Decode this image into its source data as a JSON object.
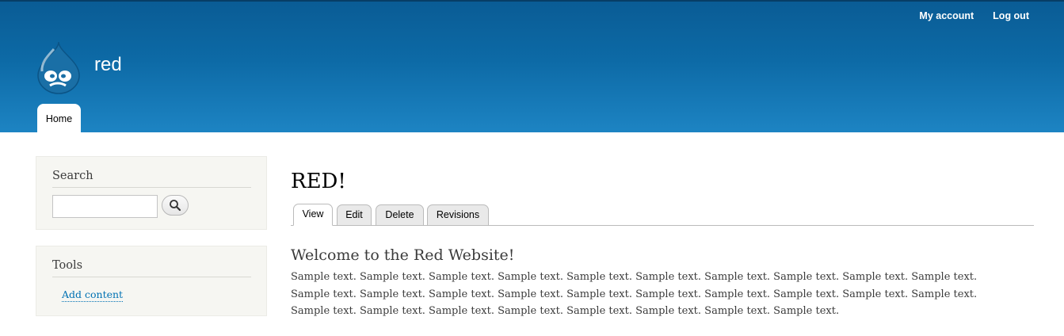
{
  "site": {
    "name": "red"
  },
  "user_menu": {
    "my_account": "My account",
    "log_out": "Log out"
  },
  "main_menu": {
    "home": "Home"
  },
  "sidebar": {
    "search": {
      "title": "Search",
      "placeholder": ""
    },
    "tools": {
      "title": "Tools",
      "add_content": "Add content"
    }
  },
  "page": {
    "title": "RED!",
    "tabs": [
      "View",
      "Edit",
      "Delete",
      "Revisions"
    ],
    "content_title": "Welcome to the Red Website!",
    "body": "Sample text. Sample text. Sample text. Sample text. Sample text. Sample text. Sample text. Sample text. Sample text. Sample text. Sample text. Sample text. Sample text. Sample text. Sample text. Sample text. Sample text. Sample text. Sample text. Sample text. Sample text. Sample text. Sample text. Sample text. Sample text. Sample text. Sample text. Sample text."
  },
  "colors": {
    "header_top": "#0a5c95",
    "header_bottom": "#1d84c3",
    "link": "#0071b3",
    "sidebar_bg": "#f6f6f2"
  }
}
